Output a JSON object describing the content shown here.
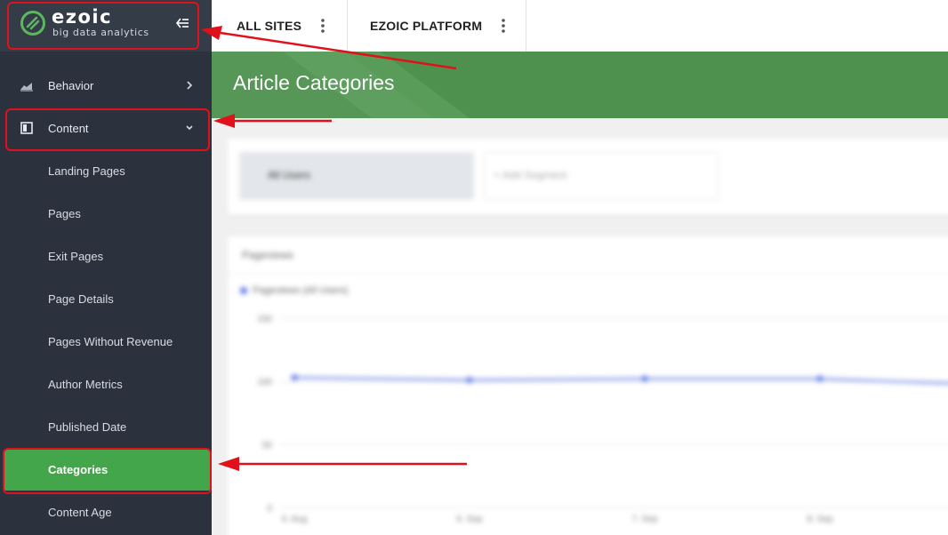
{
  "logo": {
    "word": "ezoic",
    "tagline": "big data analytics"
  },
  "sidebar": {
    "sections": [
      {
        "label": "Behavior",
        "icon": "chart-area-icon"
      },
      {
        "label": "Content",
        "icon": "dashboard-icon"
      }
    ],
    "content_items": [
      {
        "label": "Landing Pages"
      },
      {
        "label": "Pages"
      },
      {
        "label": "Exit Pages"
      },
      {
        "label": "Page Details"
      },
      {
        "label": "Pages Without Revenue"
      },
      {
        "label": "Author Metrics"
      },
      {
        "label": "Published Date"
      },
      {
        "label": "Categories",
        "active": true
      },
      {
        "label": "Content Age"
      }
    ]
  },
  "topbar": {
    "tabs": [
      {
        "label": "ALL SITES"
      },
      {
        "label": "EZOIC PLATFORM"
      }
    ]
  },
  "page": {
    "title": "Article Categories"
  },
  "segments": {
    "active": "All Users",
    "add": "+ Add Segment"
  },
  "chart": {
    "metric": "Pageviews",
    "legend": "Pageviews (All Users)"
  },
  "chart_data": {
    "type": "line",
    "title": "",
    "yticks": [
      "150",
      "100",
      "50",
      "0"
    ],
    "xticks": [
      "6. Aug",
      "6. Sep",
      "7. Sep",
      "8. Sep"
    ],
    "x": [
      "6. Aug",
      "6. Sep",
      "7. Sep",
      "8. Sep"
    ],
    "series": [
      {
        "name": "Pageviews (All Users)",
        "values": [
          103,
          101,
          102,
          102
        ]
      }
    ],
    "ylim": [
      0,
      150
    ],
    "grid": true
  },
  "colors": {
    "sidebar": "#2b323d",
    "active": "#44a64a",
    "banner": "#4e904e",
    "series": "#5b78e6",
    "annotation": "#e0111a"
  }
}
